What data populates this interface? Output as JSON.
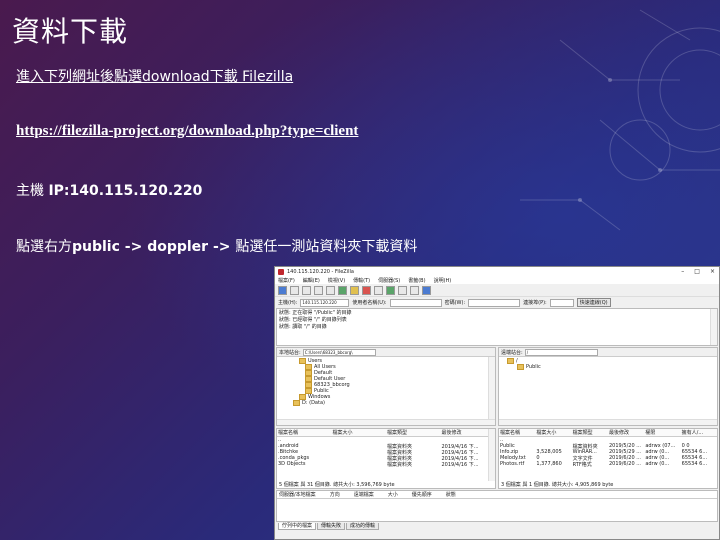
{
  "slide": {
    "title": "資料下載",
    "line1_link": "進入下列網址後點選download下載 Filezilla",
    "line2_url": "https://filezilla-project.org/download.php?type=client",
    "line3_prefix": "主機 ",
    "line3_bold": "IP:140.115.120.220",
    "line4_a": "點選右方",
    "line4_b": "public -> doppler -> ",
    "line4_c": "點選任一測站資料夾下載資料"
  },
  "filezilla": {
    "title": "140.115.120.220 - FileZilla",
    "menu": [
      "檔案(F)",
      "編輯(E)",
      "檢視(V)",
      "傳輸(T)",
      "伺服器(S)",
      "書籤(B)",
      "說明(H)"
    ],
    "quickconnect": {
      "host_label": "主機(H):",
      "host_value": "140.115.120.220",
      "user_label": "使用者名稱(U):",
      "pass_label": "密碼(W):",
      "port_label": "連接埠(P):",
      "button": "快速連線(Q)"
    },
    "log": [
      "狀態: 正在取得 \"/Public\" 的目錄",
      "狀態: 已經取得 \"/\" 的目錄列表",
      "狀態: 讀取 \"/\" 的目錄"
    ],
    "local": {
      "label": "本地站台:",
      "path": "C:\\Users\\68323_bbcorg\\",
      "tree": [
        "Users",
        "All Users",
        "Default",
        "Default User",
        "68323_bbcorg",
        "Public",
        "Windows",
        "D: (Data)"
      ],
      "columns": [
        "檔案名稱",
        "檔案大小",
        "檔案類型",
        "最後修改"
      ],
      "rows": [
        [
          "..",
          "",
          "",
          ""
        ],
        [
          ".android",
          "",
          "檔案資料夾",
          "2019/4/16 下..."
        ],
        [
          ".Bitchke",
          "",
          "檔案資料夾",
          "2019/4/16 下..."
        ],
        [
          ".conda_pkgs",
          "",
          "檔案資料夾",
          "2019/4/16 下..."
        ],
        [
          "3D Objects",
          "",
          "檔案資料夾",
          "2019/4/16 下..."
        ]
      ],
      "status": "5 個檔案 與 31 個目錄. 總共大小: 3,596,769 byte"
    },
    "remote": {
      "label": "遠端站台:",
      "path": "/",
      "tree": [
        "/",
        "Public"
      ],
      "columns": [
        "檔案名稱",
        "檔案大小",
        "檔案類型",
        "最後修改",
        "權限",
        "擁有人/..."
      ],
      "rows": [
        [
          "..",
          "",
          "",
          "",
          "",
          ""
        ],
        [
          "Public",
          "",
          "檔案資料夾",
          "2019/5/20 ...",
          "adrwx (07...",
          "0 0"
        ],
        [
          "Info.zip",
          "3,528,005",
          "WinRAR...",
          "2019/5/29 ...",
          "adrw (0...",
          "65534 6..."
        ],
        [
          "Melody.txt",
          "0",
          "文字文件",
          "2019/6/20 ...",
          "adrw (0...",
          "65534 6..."
        ],
        [
          "Photos.rtf",
          "1,377,860",
          "RTF格式",
          "2019/6/20 ...",
          "adrw (0...",
          "65534 6..."
        ]
      ],
      "status": "3 個檔案 與 1 個目錄. 總共大小: 4,905,869 byte"
    },
    "queue_columns": [
      "伺服器/本地檔案",
      "方向",
      "遠端檔案",
      "大小",
      "優先順序",
      "狀態"
    ],
    "tabs": [
      "佇列中的檔案",
      "傳輸失敗",
      "成功的傳輸"
    ]
  }
}
